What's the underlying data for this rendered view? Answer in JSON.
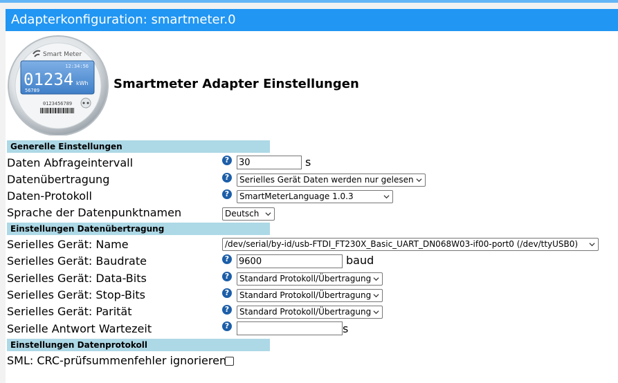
{
  "window": {
    "title": "Adapterkonfiguration: smartmeter.0"
  },
  "logo": {
    "brand": "Smart Meter",
    "time": "12:34:56",
    "reading": "01234",
    "unit": "kWh",
    "sub_reading": "56789",
    "serial": "0123456789"
  },
  "page": {
    "heading": "Smartmeter Adapter Einstellungen"
  },
  "sections": {
    "general": "Generelle Einstellungen",
    "transfer": "Einstellungen Datenübertragung",
    "protocol": "Einstellungen Datenprotokoll"
  },
  "fields": {
    "interval": {
      "label": "Daten Abfrageintervall",
      "value": "30",
      "unit": "s"
    },
    "transmission": {
      "label": "Datenübertragung",
      "value": "Serielles Gerät Daten werden nur gelesen"
    },
    "protocol": {
      "label": "Daten-Protokoll",
      "value": "SmartMeterLanguage 1.0.3"
    },
    "language": {
      "label": "Sprache der Datenpunktnamen",
      "value": "Deutsch"
    },
    "serial_name": {
      "label": "Serielles Gerät: Name",
      "value": "/dev/serial/by-id/usb-FTDI_FT230X_Basic_UART_DN068W03-if00-port0 (/dev/ttyUSB0)"
    },
    "baudrate": {
      "label": "Serielles Gerät: Baudrate",
      "value": "9600",
      "unit": "baud"
    },
    "databits": {
      "label": "Serielles Gerät: Data-Bits",
      "value": "Standard Protokoll/Übertragung"
    },
    "stopbits": {
      "label": "Serielles Gerät: Stop-Bits",
      "value": "Standard Protokoll/Übertragung"
    },
    "parity": {
      "label": "Serielles Gerät: Parität",
      "value": "Standard Protokoll/Übertragung"
    },
    "response_wait": {
      "label": "Serielle Antwort Wartezeit",
      "value": "",
      "unit": "s"
    },
    "crc_ignore": {
      "label": "SML: CRC-prüfsummenfehler ignorieren",
      "checked": false
    }
  },
  "help_glyph": "?",
  "colors": {
    "accent": "#2196f3",
    "section_bg": "#add8e6",
    "help_icon": "#1c5ea8"
  }
}
